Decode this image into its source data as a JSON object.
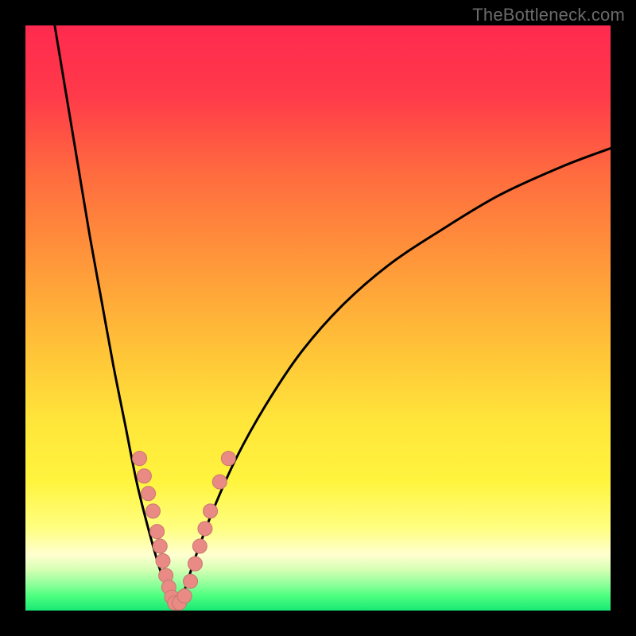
{
  "watermark": "TheBottleneck.com",
  "colors": {
    "frame": "#000000",
    "curve": "#000000",
    "marker_fill": "#e98a84",
    "marker_stroke": "#c77770",
    "gradient_stops": [
      {
        "offset": 0.0,
        "color": "#ff2a4f"
      },
      {
        "offset": 0.12,
        "color": "#ff3a4a"
      },
      {
        "offset": 0.25,
        "color": "#ff6a3f"
      },
      {
        "offset": 0.4,
        "color": "#ff963a"
      },
      {
        "offset": 0.55,
        "color": "#ffc238"
      },
      {
        "offset": 0.68,
        "color": "#ffe63a"
      },
      {
        "offset": 0.78,
        "color": "#fff43e"
      },
      {
        "offset": 0.86,
        "color": "#ffff82"
      },
      {
        "offset": 0.905,
        "color": "#ffffd0"
      },
      {
        "offset": 0.93,
        "color": "#d6ffb4"
      },
      {
        "offset": 0.955,
        "color": "#8fff9a"
      },
      {
        "offset": 0.975,
        "color": "#4dff7e"
      },
      {
        "offset": 1.0,
        "color": "#19e876"
      }
    ]
  },
  "chart_data": {
    "type": "line",
    "title": "",
    "xlabel": "",
    "ylabel": "",
    "xlim": [
      0,
      100
    ],
    "ylim": [
      0,
      100
    ],
    "note": "A V-shaped bottleneck curve. The x-axis is an implicit hardware-balance ratio; the y-axis is bottleneck severity (0 = perfectly balanced at the trough, higher = worse). The background gradient encodes severity from red (top, severe) through yellow to green (bottom, balanced). Values are estimated from pixel positions since the chart has no explicit tick labels.",
    "series": [
      {
        "name": "left-branch",
        "x": [
          5,
          7,
          9,
          11,
          13,
          15,
          17,
          19,
          21,
          23,
          24.5,
          25.5
        ],
        "y": [
          100,
          88,
          76,
          64,
          53,
          42,
          32,
          22,
          14,
          7,
          3,
          1
        ]
      },
      {
        "name": "right-branch",
        "x": [
          25.5,
          27,
          29,
          32,
          36,
          41,
          47,
          54,
          62,
          71,
          81,
          92,
          100
        ],
        "y": [
          1,
          3,
          9,
          17,
          26,
          35,
          44,
          52,
          59,
          65,
          71,
          76,
          79
        ]
      }
    ],
    "markers": {
      "name": "highlighted-points",
      "comment": "Salmon circular markers clustered on both branches near the trough.",
      "points": [
        {
          "x": 19.5,
          "y": 26
        },
        {
          "x": 20.3,
          "y": 23
        },
        {
          "x": 21.0,
          "y": 20
        },
        {
          "x": 21.8,
          "y": 17
        },
        {
          "x": 22.5,
          "y": 13.5
        },
        {
          "x": 23.0,
          "y": 11
        },
        {
          "x": 23.5,
          "y": 8.5
        },
        {
          "x": 24.0,
          "y": 6
        },
        {
          "x": 24.5,
          "y": 4
        },
        {
          "x": 25.0,
          "y": 2.3
        },
        {
          "x": 25.5,
          "y": 1.3
        },
        {
          "x": 26.3,
          "y": 1.3
        },
        {
          "x": 27.2,
          "y": 2.5
        },
        {
          "x": 28.2,
          "y": 5
        },
        {
          "x": 29.0,
          "y": 8
        },
        {
          "x": 29.8,
          "y": 11
        },
        {
          "x": 30.7,
          "y": 14
        },
        {
          "x": 31.6,
          "y": 17
        },
        {
          "x": 33.2,
          "y": 22
        },
        {
          "x": 34.7,
          "y": 26
        }
      ]
    }
  }
}
